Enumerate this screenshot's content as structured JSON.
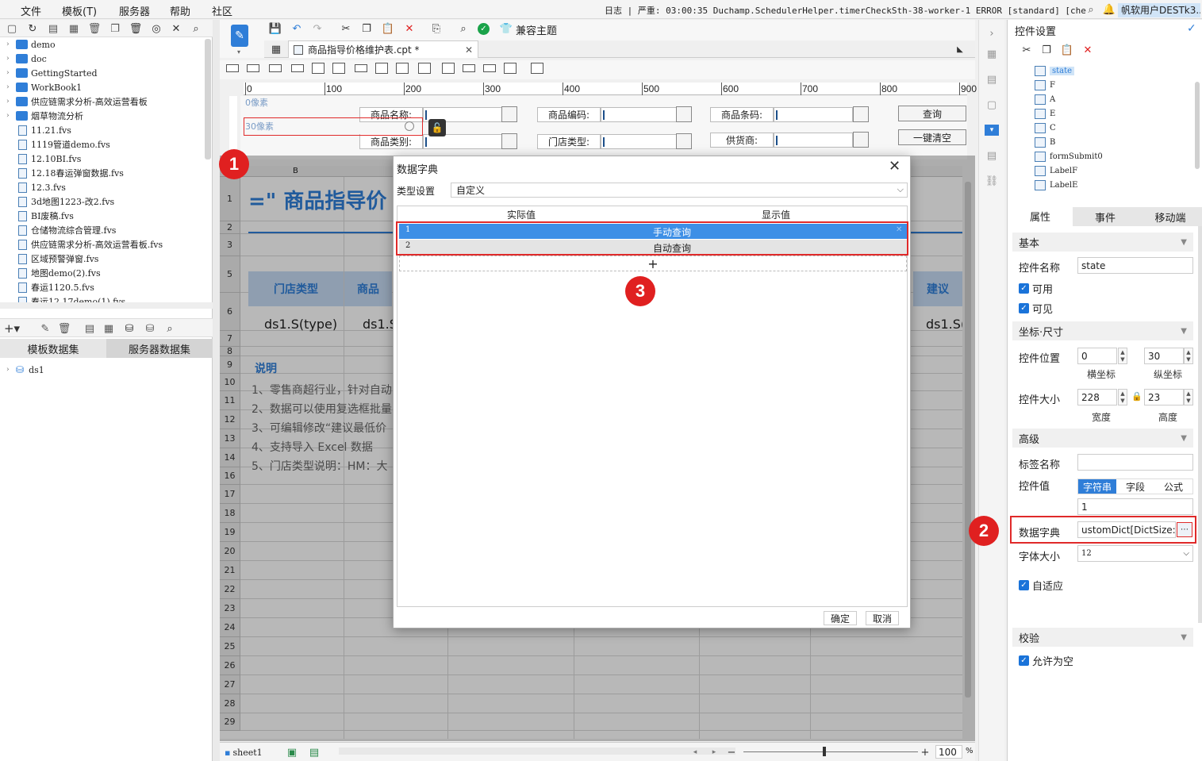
{
  "menu": {
    "file": "文件",
    "template": "模板(T)",
    "server": "服务器",
    "help": "帮助",
    "community": "社区",
    "log_label": "日志",
    "log_text": "严重: 03:00:35 Duchamp.SchedulerHelper.timerCheckSth-38-worker-1 ERROR [standard] [check in...",
    "user": "帆软用户DESTk3..."
  },
  "file_tree": [
    {
      "name": "demo",
      "type": "folder"
    },
    {
      "name": "doc",
      "type": "folder"
    },
    {
      "name": "GettingStarted",
      "type": "folder"
    },
    {
      "name": "WorkBook1",
      "type": "folder"
    },
    {
      "name": "供应链需求分析-高效运营看板",
      "type": "folder"
    },
    {
      "name": "烟草物流分析",
      "type": "folder"
    },
    {
      "name": "11.21.fvs",
      "type": "file"
    },
    {
      "name": "1119管道demo.fvs",
      "type": "file"
    },
    {
      "name": "12.10BI.fvs",
      "type": "file"
    },
    {
      "name": "12.18春运弹窗数据.fvs",
      "type": "file"
    },
    {
      "name": "12.3.fvs",
      "type": "file"
    },
    {
      "name": "3d地图1223-改2.fvs",
      "type": "file"
    },
    {
      "name": "BI废稿.fvs",
      "type": "file"
    },
    {
      "name": "仓储物流综合管理.fvs",
      "type": "file"
    },
    {
      "name": "供应链需求分析-高效运营看板.fvs",
      "type": "file"
    },
    {
      "name": "区域预警弹窗.fvs",
      "type": "file"
    },
    {
      "name": "地图demo(2).fvs",
      "type": "file"
    },
    {
      "name": "春运1120.5.fvs",
      "type": "file"
    },
    {
      "name": "春运12.17demo(1).fvs",
      "type": "file"
    }
  ],
  "dataset_tabs": {
    "template": "模板数据集",
    "server": "服务器数据集"
  },
  "dataset_item": "ds1",
  "toolbar": {
    "compat_theme": "兼容主题"
  },
  "doc_tab": "商品指导价格维护表.cpt *",
  "ruler": [
    "0",
    "100",
    "200",
    "300",
    "400",
    "500",
    "600",
    "700",
    "800",
    "900"
  ],
  "param_pane": {
    "px0": "0像素",
    "px30": "30像素",
    "labels": [
      "商品名称:",
      "商品编码:",
      "商品条码:",
      "商品类别:",
      "门店类型:",
      "供货商:"
    ],
    "query": "查询",
    "clear": "一键清空"
  },
  "sheet": {
    "col_b": "B",
    "title": "=\" 商品指导价",
    "rows": [
      "1",
      "2",
      "3",
      "5",
      "6",
      "7",
      "8",
      "9",
      "10",
      "11",
      "12",
      "13",
      "14",
      "16",
      "17",
      "18",
      "19",
      "20",
      "21",
      "22",
      "23",
      "24",
      "25",
      "26",
      "27",
      "28",
      "29"
    ],
    "header_store_type": "门店类型",
    "header_product": "商品",
    "header_suggest": "建议",
    "cell_type": "ds1.S(type)",
    "cell_s": "ds1.S",
    "cell_s2": "ds1.S(",
    "notes_title": "说明",
    "notes": [
      "1、零售商超行业，针对自动",
      "2、数据可以使用复选框批量",
      "3、可编辑修改“建议最低价",
      "4、支持导入 Excel 数据",
      "5、门店类型说明：HM：大"
    ]
  },
  "statusbar": {
    "sheet": "sheet1",
    "zoom": "100",
    "zoom_unit": "%"
  },
  "dialog": {
    "title": "数据字典",
    "type_label": "类型设置",
    "type_value": "自定义",
    "col_actual": "实际值",
    "col_display": "显示值",
    "rows": [
      {
        "actual": "1",
        "display": "手动查询"
      },
      {
        "actual": "2",
        "display": "自动查询"
      }
    ],
    "add": "+",
    "ok": "确定",
    "cancel": "取消"
  },
  "right_panel": {
    "title": "控件设置",
    "tree": [
      "state",
      "F",
      "A",
      "E",
      "C",
      "B",
      "formSubmit0",
      "LabelF",
      "LabelE"
    ],
    "tabs": [
      "属性",
      "事件",
      "移动端"
    ],
    "sec_basic": "基本",
    "name_label": "控件名称",
    "name_value": "state",
    "enabled": "可用",
    "visible": "可见",
    "sec_geom": "坐标·尺寸",
    "pos_label": "控件位置",
    "pos_x": "0",
    "pos_y": "30",
    "x_lbl": "横坐标",
    "y_lbl": "纵坐标",
    "size_label": "控件大小",
    "width": "228",
    "height": "23",
    "w_lbl": "宽度",
    "h_lbl": "高度",
    "sec_adv": "高级",
    "tag_label": "标签名称",
    "value_label": "控件值",
    "value_tabs": [
      "字符串",
      "字段",
      "公式"
    ],
    "value": "1",
    "dict_label": "数据字典",
    "dict_value": "ustomDict[DictSize:2]",
    "font_label": "字体大小",
    "font_value": "12",
    "adaptive": "自适应",
    "sec_check": "校验",
    "allow_empty": "允许为空"
  },
  "badges": [
    "1",
    "2",
    "3"
  ],
  "colors": {
    "accent": "#1a73d9",
    "header_blue": "#c7dcf4",
    "selected_row": "#3d8fe6",
    "annotation_red": "#e02020"
  }
}
